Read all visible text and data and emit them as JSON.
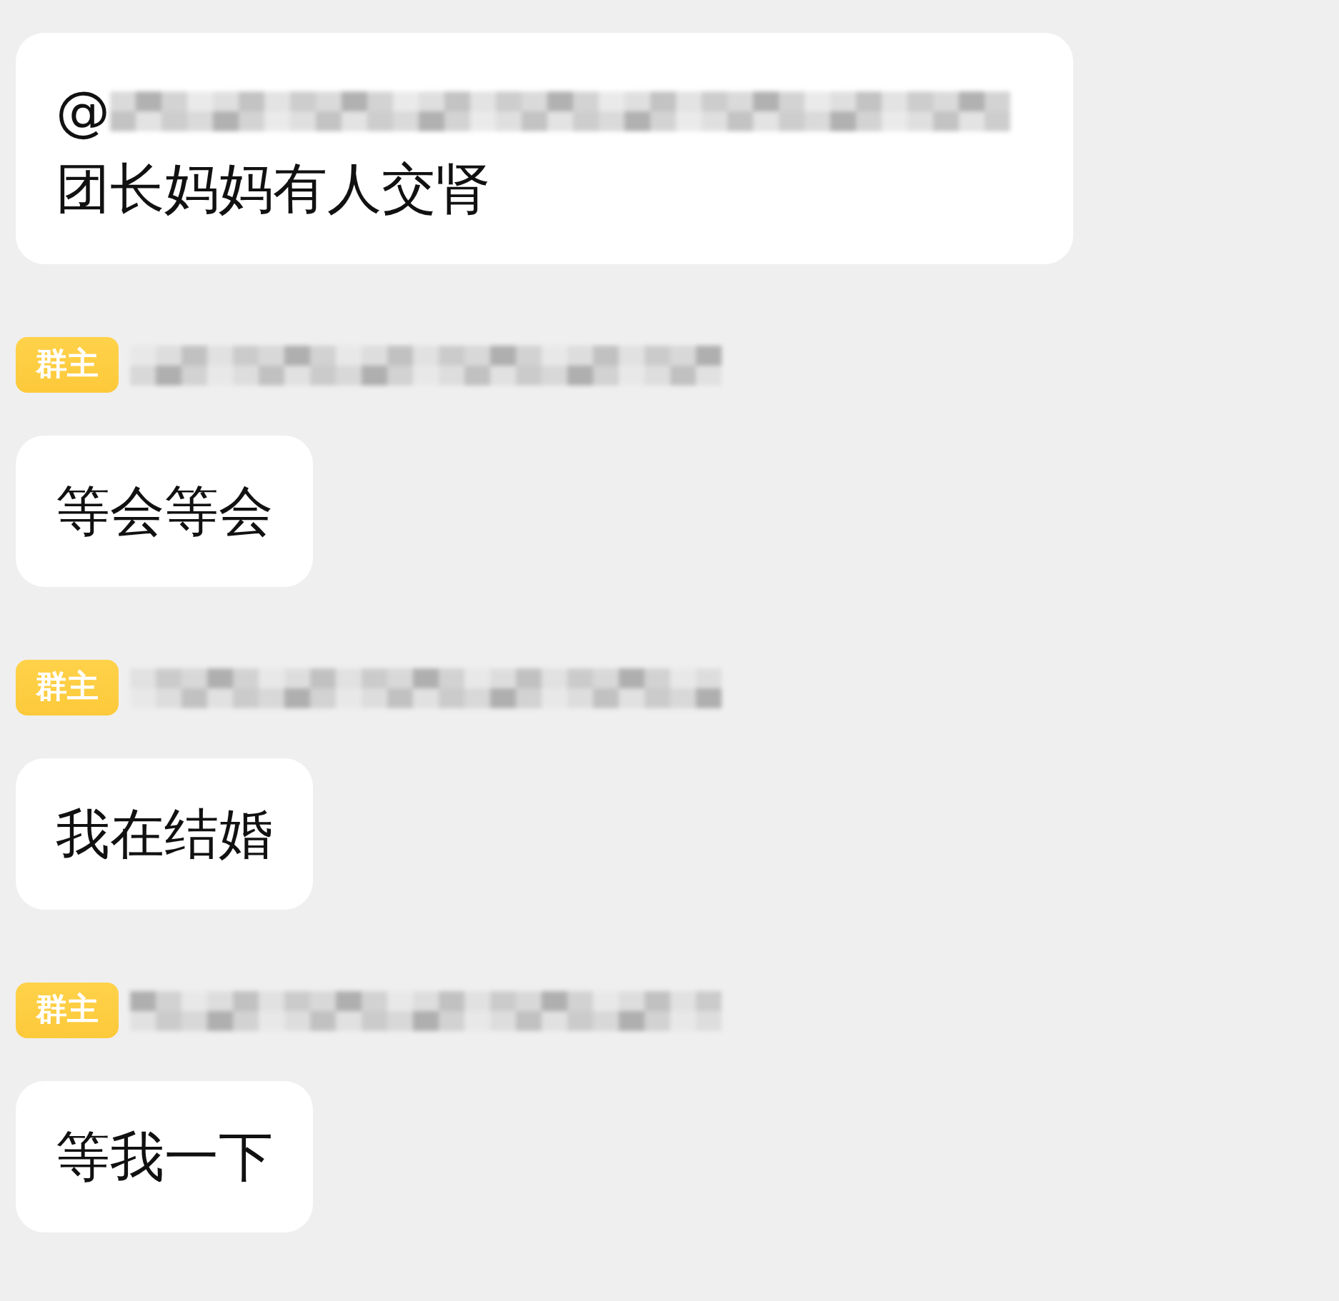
{
  "messages": [
    {
      "kind": "mention",
      "at": "@",
      "text": "团长妈妈有人交肾"
    },
    {
      "kind": "owner",
      "badge": "群主",
      "text": "等会等会"
    },
    {
      "kind": "owner",
      "badge": "群主",
      "text": "我在结婚"
    },
    {
      "kind": "owner",
      "badge": "群主",
      "text": "等我一下"
    }
  ]
}
